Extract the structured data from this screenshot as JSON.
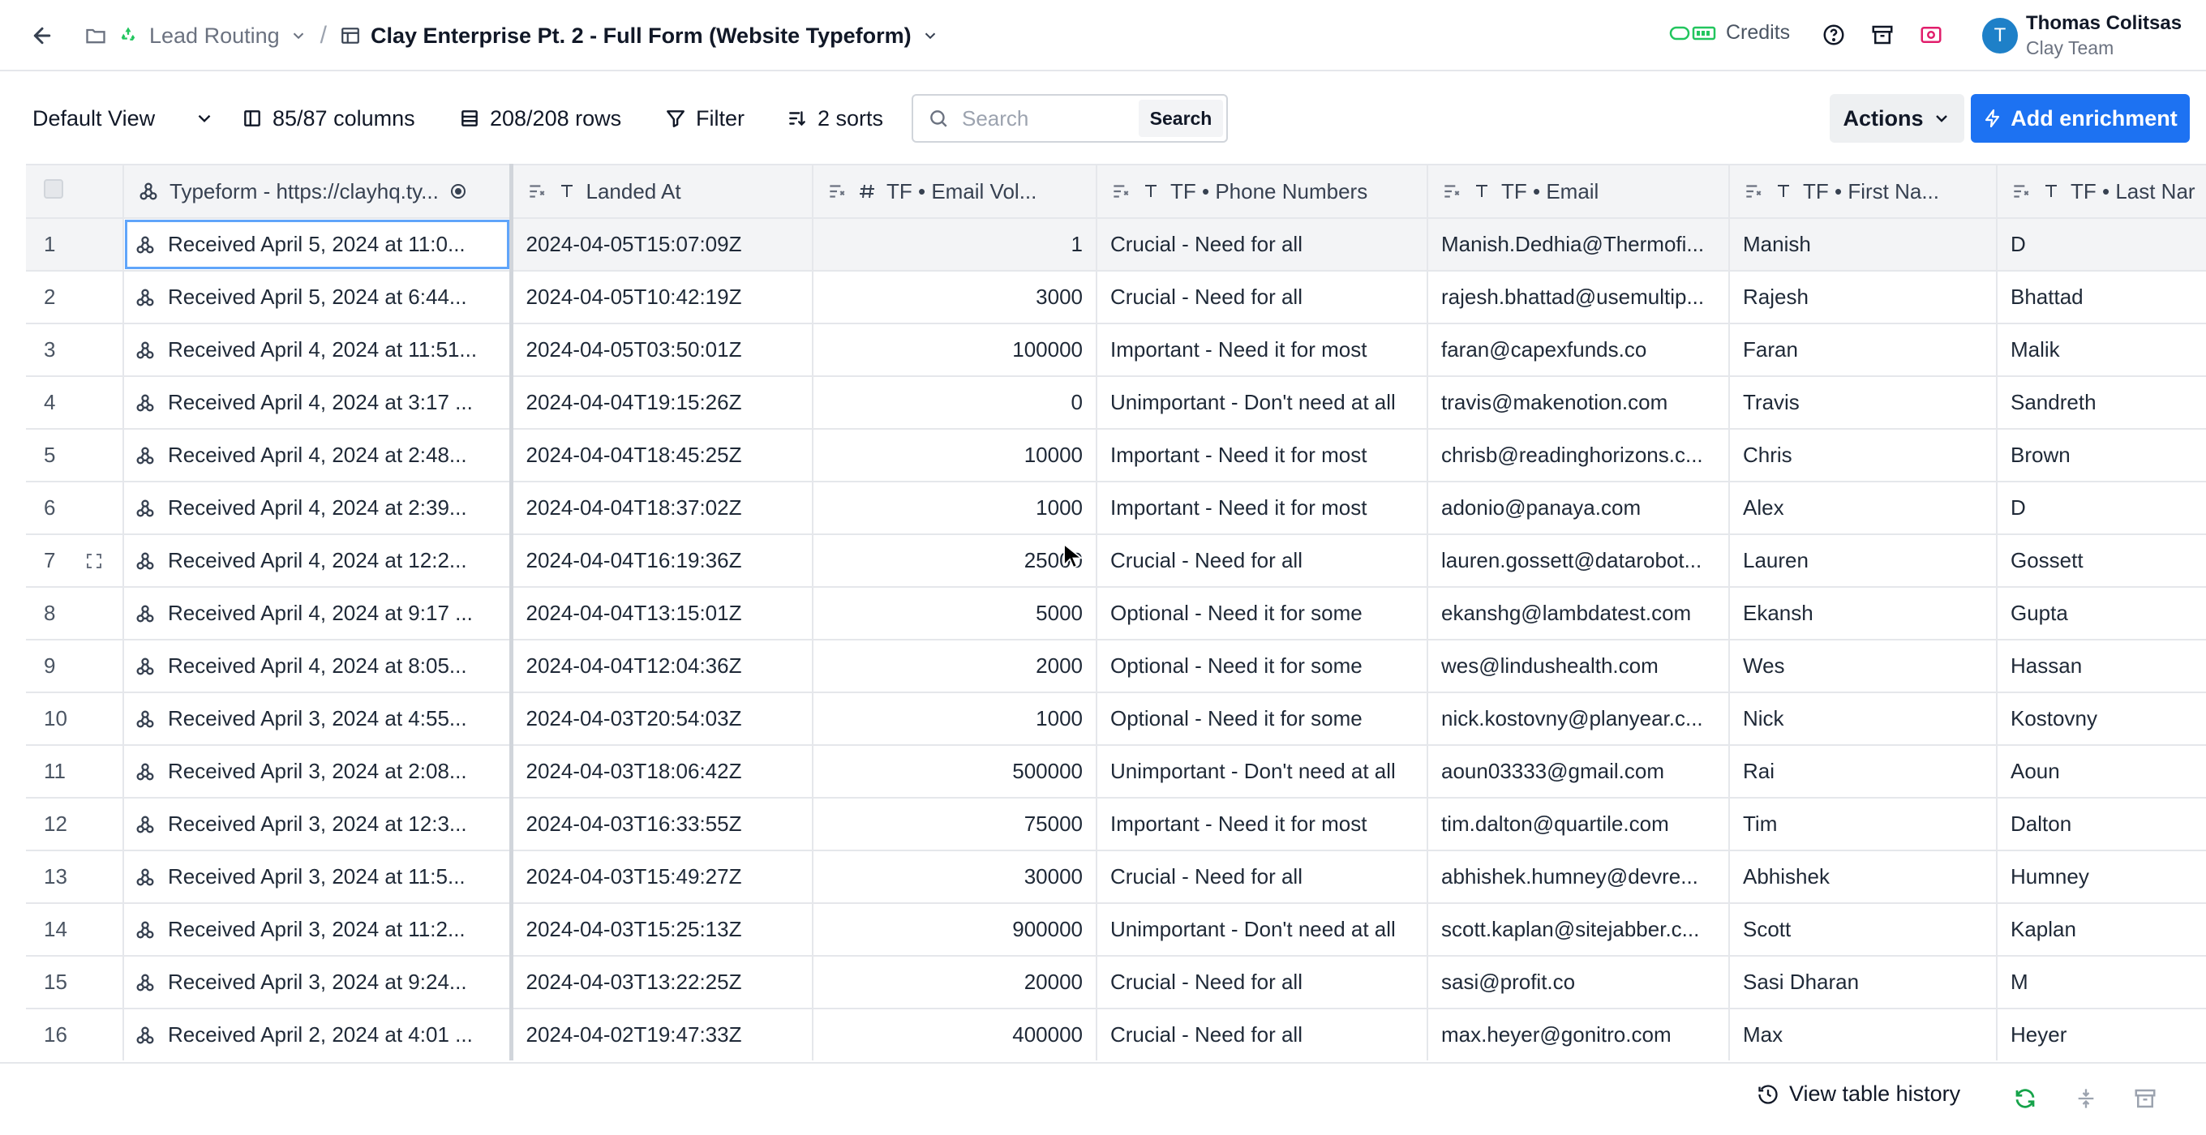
{
  "breadcrumb": {
    "workspace": "Lead Routing",
    "table": "Clay Enterprise Pt. 2 - Full Form (Website Typeform)"
  },
  "header": {
    "credits_label": "Credits",
    "user_name": "Thomas Colitsas",
    "user_team": "Clay Team",
    "avatar_initial": "T"
  },
  "toolbar": {
    "view": "Default View",
    "columns": "85/87 columns",
    "rows": "208/208 rows",
    "filter": "Filter",
    "sorts": "2 sorts",
    "search_placeholder": "Search",
    "search_button": "Search",
    "actions": "Actions",
    "add_enrichment": "Add enrichment"
  },
  "table": {
    "columns": [
      "Typeform - https://clayhq.ty...",
      "Landed At",
      "TF • Email Vol...",
      "TF • Phone Numbers",
      "TF • Email",
      "TF • First Na...",
      "TF • Last Nar"
    ],
    "rows": [
      {
        "n": "1",
        "typeform": "Received April 5, 2024 at 11:0...",
        "landed": "2024-04-05T15:07:09Z",
        "vol": "1",
        "phone": "Crucial - Need for all",
        "email": "Manish.Dedhia@Thermofi...",
        "first": "Manish",
        "last": "D"
      },
      {
        "n": "2",
        "typeform": "Received April 5, 2024 at 6:44...",
        "landed": "2024-04-05T10:42:19Z",
        "vol": "3000",
        "phone": "Crucial - Need for all",
        "email": "rajesh.bhattad@usemultip...",
        "first": "Rajesh",
        "last": "Bhattad"
      },
      {
        "n": "3",
        "typeform": "Received April 4, 2024 at 11:51...",
        "landed": "2024-04-05T03:50:01Z",
        "vol": "100000",
        "phone": "Important - Need it for most",
        "email": "faran@capexfunds.co",
        "first": "Faran",
        "last": "Malik"
      },
      {
        "n": "4",
        "typeform": "Received April 4, 2024 at 3:17 ...",
        "landed": "2024-04-04T19:15:26Z",
        "vol": "0",
        "phone": "Unimportant - Don't need at all",
        "email": "travis@makenotion.com",
        "first": "Travis",
        "last": "Sandreth"
      },
      {
        "n": "5",
        "typeform": "Received April 4, 2024 at 2:48...",
        "landed": "2024-04-04T18:45:25Z",
        "vol": "10000",
        "phone": "Important - Need it for most",
        "email": "chrisb@readinghorizons.c...",
        "first": "Chris",
        "last": "Brown"
      },
      {
        "n": "6",
        "typeform": "Received April 4, 2024 at 2:39...",
        "landed": "2024-04-04T18:37:02Z",
        "vol": "1000",
        "phone": "Important - Need it for most",
        "email": "adonio@panaya.com",
        "first": "Alex",
        "last": "D"
      },
      {
        "n": "7",
        "typeform": "Received April 4, 2024 at 12:2...",
        "landed": "2024-04-04T16:19:36Z",
        "vol": "25000",
        "phone": "Crucial - Need for all",
        "email": "lauren.gossett@datarobot...",
        "first": "Lauren",
        "last": "Gossett"
      },
      {
        "n": "8",
        "typeform": "Received April 4, 2024 at 9:17 ...",
        "landed": "2024-04-04T13:15:01Z",
        "vol": "5000",
        "phone": "Optional - Need it for some",
        "email": "ekanshg@lambdatest.com",
        "first": "Ekansh",
        "last": "Gupta"
      },
      {
        "n": "9",
        "typeform": "Received April 4, 2024 at 8:05...",
        "landed": "2024-04-04T12:04:36Z",
        "vol": "2000",
        "phone": "Optional - Need it for some",
        "email": "wes@lindushealth.com",
        "first": "Wes",
        "last": "Hassan"
      },
      {
        "n": "10",
        "typeform": "Received April 3, 2024 at 4:55...",
        "landed": "2024-04-03T20:54:03Z",
        "vol": "1000",
        "phone": "Optional - Need it for some",
        "email": "nick.kostovny@planyear.c...",
        "first": "Nick",
        "last": "Kostovny"
      },
      {
        "n": "11",
        "typeform": "Received April 3, 2024 at 2:08...",
        "landed": "2024-04-03T18:06:42Z",
        "vol": "500000",
        "phone": "Unimportant - Don't need at all",
        "email": "aoun03333@gmail.com",
        "first": "Rai",
        "last": "Aoun"
      },
      {
        "n": "12",
        "typeform": "Received April 3, 2024 at 12:3...",
        "landed": "2024-04-03T16:33:55Z",
        "vol": "75000",
        "phone": "Important - Need it for most",
        "email": "tim.dalton@quartile.com",
        "first": "Tim",
        "last": "Dalton"
      },
      {
        "n": "13",
        "typeform": "Received April 3, 2024 at 11:5...",
        "landed": "2024-04-03T15:49:27Z",
        "vol": "30000",
        "phone": "Crucial - Need for all",
        "email": "abhishek.humney@devre...",
        "first": "Abhishek",
        "last": "Humney"
      },
      {
        "n": "14",
        "typeform": "Received April 3, 2024 at 11:2...",
        "landed": "2024-04-03T15:25:13Z",
        "vol": "900000",
        "phone": "Unimportant - Don't need at all",
        "email": "scott.kaplan@sitejabber.c...",
        "first": "Scott",
        "last": "Kaplan"
      },
      {
        "n": "15",
        "typeform": "Received April 3, 2024 at 9:24...",
        "landed": "2024-04-03T13:22:25Z",
        "vol": "20000",
        "phone": "Crucial - Need for all",
        "email": "sasi@profit.co",
        "first": "Sasi Dharan",
        "last": "M"
      },
      {
        "n": "16",
        "typeform": "Received April 2, 2024 at 4:01 ...",
        "landed": "2024-04-02T19:47:33Z",
        "vol": "400000",
        "phone": "Crucial - Need for all",
        "email": "max.heyer@gonitro.com",
        "first": "Max",
        "last": "Heyer"
      }
    ]
  },
  "footer": {
    "history": "View table history"
  },
  "colors": {
    "accent": "#1d72f2",
    "credits_green": "#22c55e",
    "media_pink": "#e11d6b",
    "refresh_green": "#16a34a"
  },
  "icons": {
    "back": "arrow-left-icon",
    "folder": "folder-icon",
    "recycle": "recycle-icon",
    "table": "table-icon",
    "webhook": "webhook-icon"
  }
}
